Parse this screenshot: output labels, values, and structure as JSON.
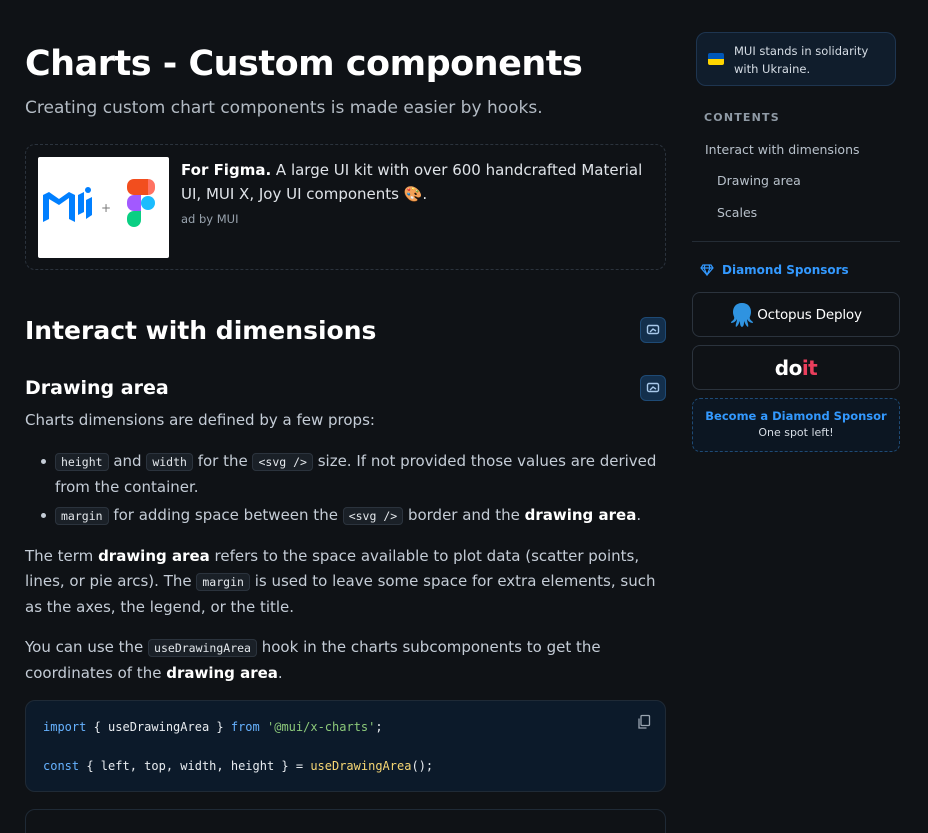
{
  "page": {
    "title": "Charts - Custom components",
    "subtitle": "Creating custom chart components is made easier by hooks."
  },
  "ad": {
    "title": "For Figma.",
    "text": " A large UI kit with over 600 handcrafted Material UI, MUI X, Joy UI components 🎨.",
    "by": "ad by MUI"
  },
  "sections": {
    "h2": "Interact with dimensions",
    "h3": "Drawing area",
    "intro": "Charts dimensions are defined by a few props:",
    "bullet1": {
      "code_height": "height",
      "and": " and ",
      "code_width": "width",
      "for_the": " for the ",
      "code_svg": "<svg />",
      "rest": " size. If not provided those values are derived from the container."
    },
    "bullet2": {
      "code_margin": "margin",
      "mid": " for adding space between the ",
      "code_svg": "<svg />",
      "mid2": " border and the ",
      "bold": "drawing area",
      "end": "."
    },
    "para1": {
      "start": "The term ",
      "bold": "drawing area",
      "mid": " refers to the space available to plot data (scatter points, lines, or pie arcs). The ",
      "code": "margin",
      "end": " is used to leave some space for extra elements, such as the axes, the legend, or the title."
    },
    "para2": {
      "start": "You can use the ",
      "code": "useDrawingArea",
      "mid": " hook in the charts subcomponents to get the coordinates of the ",
      "bold": "drawing area",
      "end": "."
    }
  },
  "code_block": {
    "line1": {
      "kw_import": "import",
      "braces": " { useDrawingArea } ",
      "kw_from": "from",
      "space": " ",
      "module": "'@mui/x-charts'",
      "semi": ";"
    },
    "line2": {
      "kw_const": "const",
      "destructure": " { left, top, width, height } = ",
      "fn": "useDrawingArea",
      "tail": "();"
    }
  },
  "sidebar": {
    "ukraine_text": "MUI stands in solidarity with Ukraine.",
    "toc_heading": "CONTENTS",
    "toc_items": [
      "Interact with dimensions",
      "Drawing area",
      "Scales"
    ],
    "sponsors_heading": "Diamond Sponsors",
    "sponsor1": "Octopus Deploy",
    "sponsor2_a": "do",
    "sponsor2_b": "it",
    "become_title": "Become a Diamond Sponsor",
    "become_sub": "One spot left!"
  },
  "colors": {
    "background": "#0f1216",
    "accent": "#3399ff",
    "heading": "#ffffff",
    "code_keyword": "#66b2ff",
    "code_string": "#8cc97a",
    "code_function": "#f7d774"
  },
  "icons": [
    "mui-logo-icon",
    "figma-logo-icon",
    "anchor-link-icon",
    "copy-icon",
    "diamond-icon",
    "octopus-icon",
    "ukraine-flag-icon"
  ]
}
